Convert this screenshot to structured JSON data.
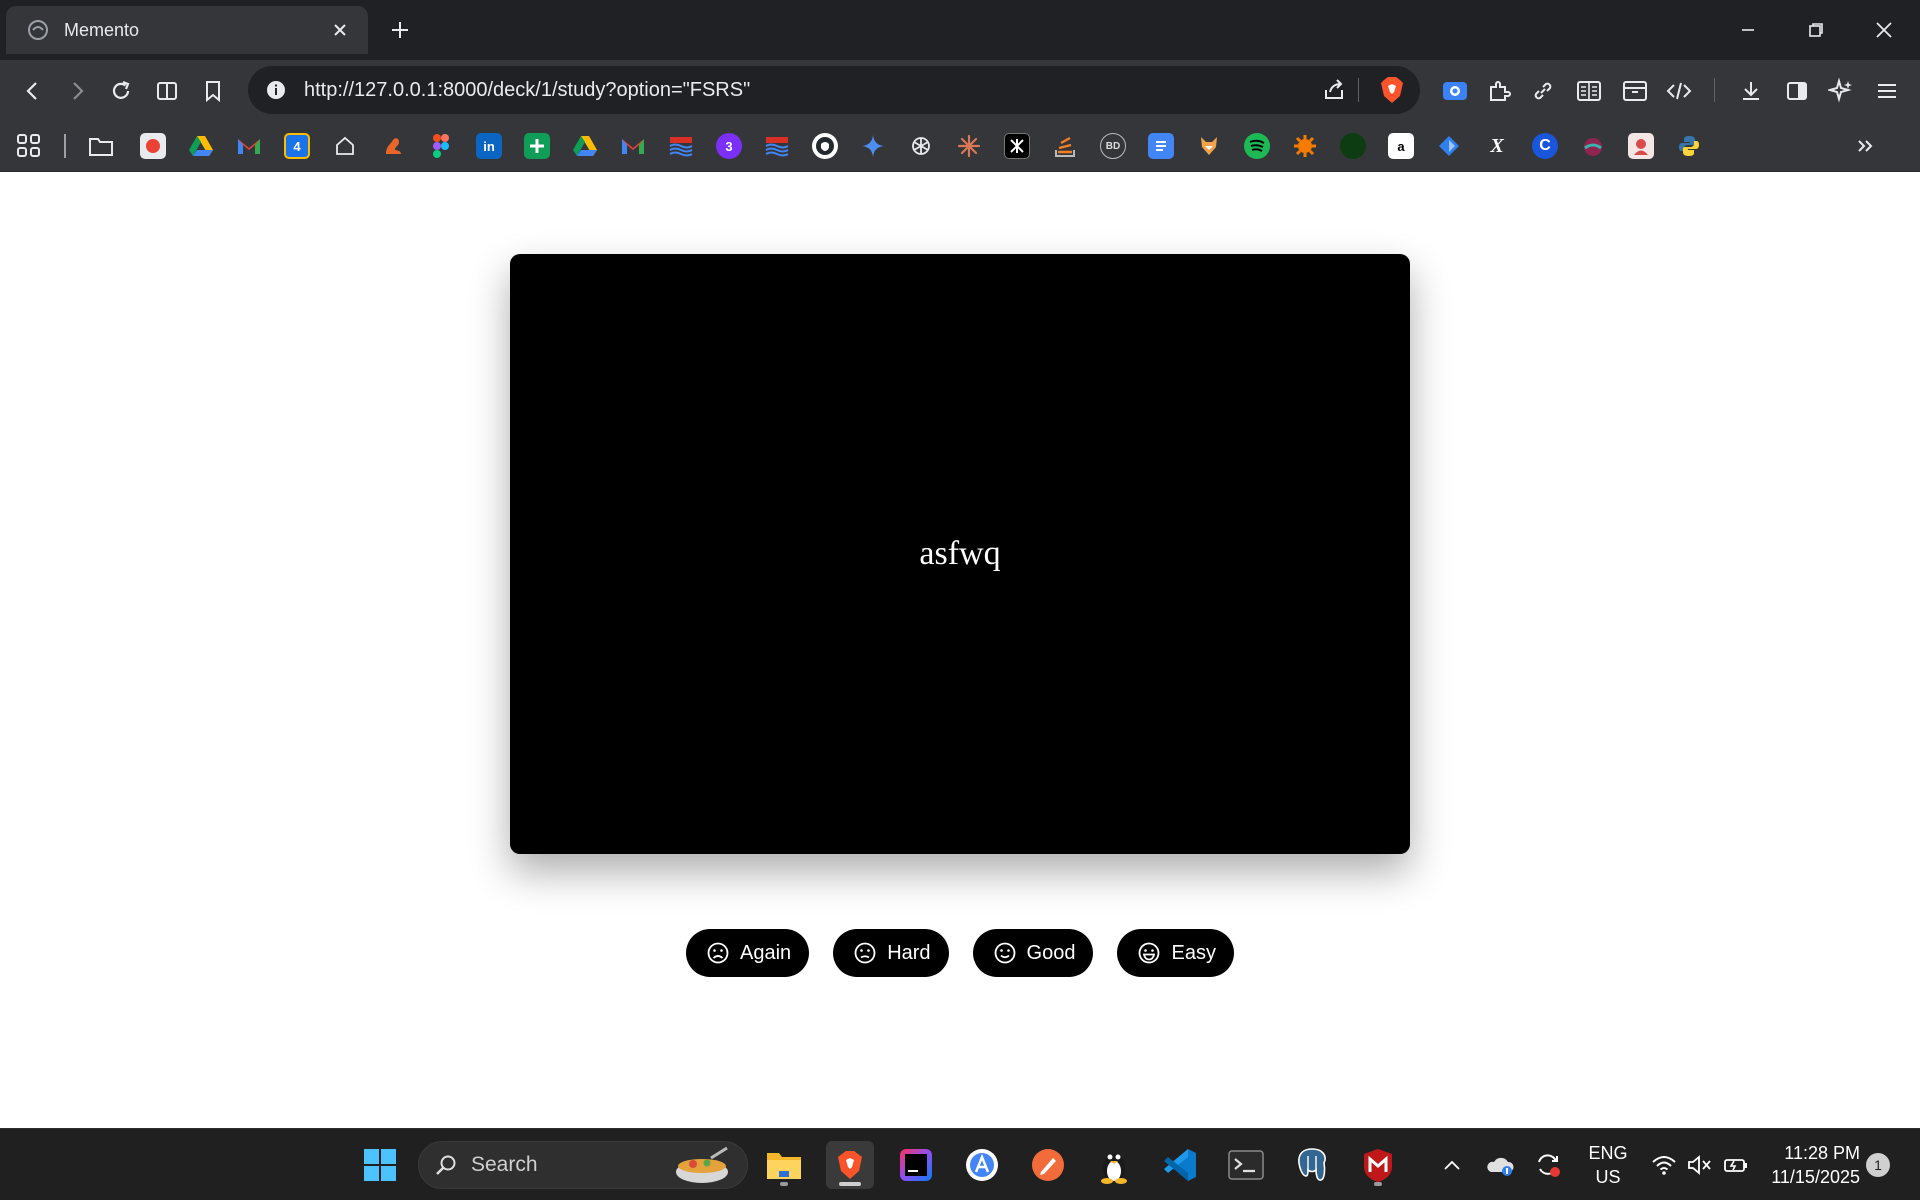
{
  "browser": {
    "tab_title": "Memento",
    "url": "http://127.0.0.1:8000/deck/1/study?option=\"FSRS\"",
    "accent_color": "#fb542b"
  },
  "card": {
    "text": "asfwq"
  },
  "ratings": [
    {
      "label": "Again",
      "icon": "sad-face-icon"
    },
    {
      "label": "Hard",
      "icon": "frown-face-icon"
    },
    {
      "label": "Good",
      "icon": "smile-face-icon"
    },
    {
      "label": "Easy",
      "icon": "grin-face-icon"
    }
  ],
  "taskbar": {
    "search_label": "Search",
    "language_line1": "ENG",
    "language_line2": "US",
    "time": "11:28 PM",
    "date": "11/15/2025",
    "notification_count": "1"
  },
  "bookmark_labels": {
    "calendar_day": "4",
    "linkedin": "in",
    "extension_e": "3",
    "amazon": "a",
    "x_bookmark": "X",
    "c_bookmark": "C",
    "bd_bookmark": "BD"
  }
}
